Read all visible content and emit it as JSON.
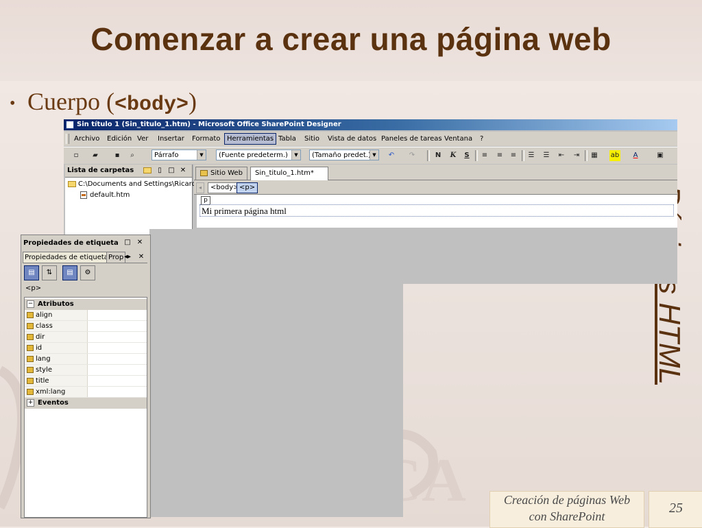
{
  "slide": {
    "title": "Comenzar a crear una página web",
    "bullet_text": "Cuerpo (",
    "bullet_code": "<body>",
    "bullet_close": ")",
    "side_text": "Páginas HTML",
    "footer_line1": "Creación de páginas Web",
    "footer_line2": "con SharePoint",
    "page_number": "25"
  },
  "app": {
    "window_title": "Sin título 1 (Sin_titulo_1.htm) - Microsoft Office SharePoint Designer",
    "menu": [
      "Archivo",
      "Edición",
      "Ver",
      "Insertar",
      "Formato",
      "Herramientas",
      "Tabla",
      "Sitio",
      "Vista de datos",
      "Paneles de tareas",
      "Ventana",
      "?"
    ],
    "active_menu": "Herramientas",
    "toolbar": {
      "style_combo": "Párrafo",
      "font_combo": "(Fuente predeterm.)",
      "size_combo": "(Tamaño predet.)",
      "bold": "N",
      "italic": "K",
      "underline": "S"
    },
    "folder_panel": {
      "title": "Lista de carpetas",
      "root_path": "C:\\Documents and Settings\\Ricardo...",
      "file": "default.htm"
    },
    "editor": {
      "tabs": [
        "Sitio Web",
        "Sin_titulo_1.htm*"
      ],
      "quick_tags": [
        "<body>",
        "<p>"
      ],
      "p_marker": "p",
      "content_line": "Mi primera página html"
    }
  },
  "properties_panel": {
    "title": "Propiedades de etiqueta",
    "tabs": [
      "Propiedades de etiqueta",
      "Prop"
    ],
    "current_tag": "<p>",
    "group_attributes": "Atributos",
    "attributes": [
      "align",
      "class",
      "dir",
      "id",
      "lang",
      "style",
      "title",
      "xml:lang"
    ],
    "group_events": "Eventos"
  },
  "colors": {
    "title_color": "#5b3210",
    "titlebar_start": "#0a246a",
    "chrome": "#d4d0c8"
  }
}
